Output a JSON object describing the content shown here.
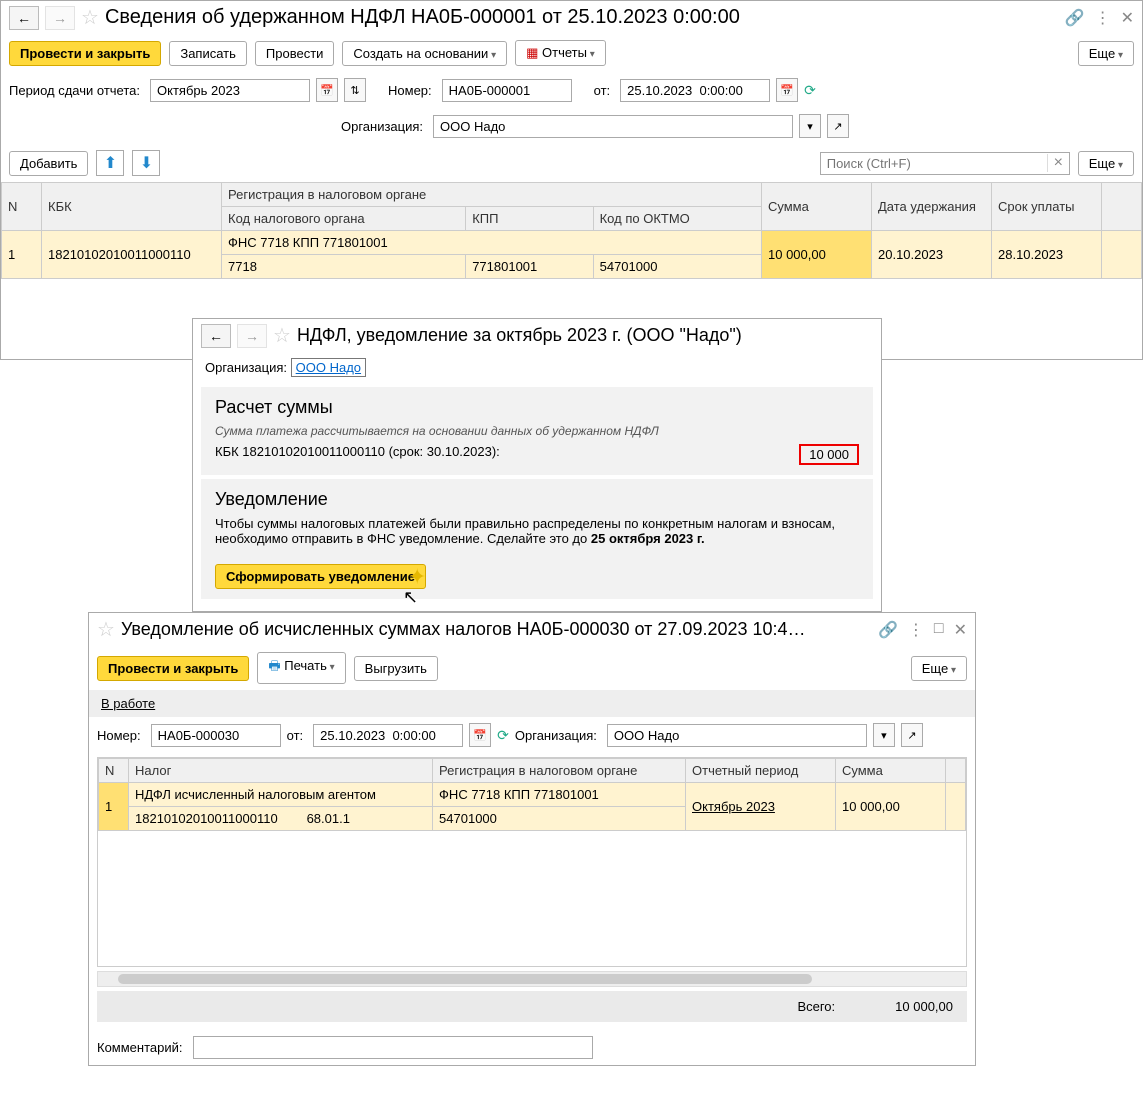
{
  "w1": {
    "title": "Сведения об удержанном НДФЛ НА0Б-000001 от 25.10.2023 0:00:00",
    "btn_post_close": "Провести и закрыть",
    "btn_save": "Записать",
    "btn_post": "Провести",
    "btn_create_based": "Создать на основании",
    "btn_reports": "Отчеты",
    "btn_more": "Еще",
    "lbl_period": "Период сдачи отчета:",
    "val_period": "Октябрь 2023",
    "lbl_number": "Номер:",
    "val_number": "НА0Б-000001",
    "lbl_from": "от:",
    "val_date": "25.10.2023  0:00:00",
    "lbl_org": "Организация:",
    "val_org": "ООО Надо",
    "btn_add": "Добавить",
    "search_placeholder": "Поиск (Ctrl+F)",
    "grid": {
      "h_n": "N",
      "h_kbk": "КБК",
      "h_reg": "Регистрация в налоговом органе",
      "h_code": "Код налогового органа",
      "h_kpp": "КПП",
      "h_oktmo": "Код по ОКТМО",
      "h_sum": "Сумма",
      "h_holddate": "Дата удержания",
      "h_due": "Срок уплаты",
      "r1_n": "1",
      "r1_kbk": "18210102010011000110",
      "r1_reg": "ФНС 7718 КПП 771801001",
      "r1_code": "7718",
      "r1_kpp": "771801001",
      "r1_oktmo": "54701000",
      "r1_sum": "10 000,00",
      "r1_holddate": "20.10.2023",
      "r1_due": "28.10.2023"
    }
  },
  "w2": {
    "title": "НДФЛ, уведомление за октябрь 2023 г. (ООО \"Надо\")",
    "lbl_org": "Организация:",
    "link_org": "ООО Надо",
    "h_calc": "Расчет суммы",
    "calc_note": "Сумма платежа рассчитывается на основании данных об удержанном НДФЛ",
    "kbk_line": "КБК 18210102010011000110 (срок: 30.10.2023):",
    "kbk_sum": "10 000",
    "h_notif": "Уведомление",
    "notif_text1": "Чтобы суммы налоговых платежей были правильно распределены по конкретным налогам и взносам, необходимо отправить в ФНС уведомление. Сделайте это до ",
    "notif_bold": "25 октября 2023 г.",
    "btn_form": "Сформировать уведомление"
  },
  "w3": {
    "title": "Уведомление об исчисленных суммах налогов НА0Б-000030 от 27.09.2023 10:4…",
    "btn_post_close": "Провести и закрыть",
    "btn_print": "Печать",
    "btn_export": "Выгрузить",
    "btn_more": "Еще",
    "status": "В работе",
    "lbl_number": "Номер:",
    "val_number": "НА0Б-000030",
    "lbl_from": "от:",
    "val_date": "25.10.2023  0:00:00",
    "lbl_org": "Организация:",
    "val_org": "ООО Надо",
    "grid": {
      "h_n": "N",
      "h_tax": "Налог",
      "h_reg": "Регистрация в налоговом органе",
      "h_period": "Отчетный период",
      "h_sum": "Сумма",
      "r1_n": "1",
      "r1_tax": "НДФЛ исчисленный налоговым агентом",
      "r1_kbk": "18210102010011000110",
      "r1_acct": "68.01.1",
      "r1_reg": "ФНС 7718 КПП 771801001",
      "r1_oktmo": "54701000",
      "r1_period": "Октябрь 2023",
      "r1_sum": "10 000,00"
    },
    "lbl_total": "Всего:",
    "val_total": "10 000,00",
    "lbl_comment": "Комментарий:"
  }
}
